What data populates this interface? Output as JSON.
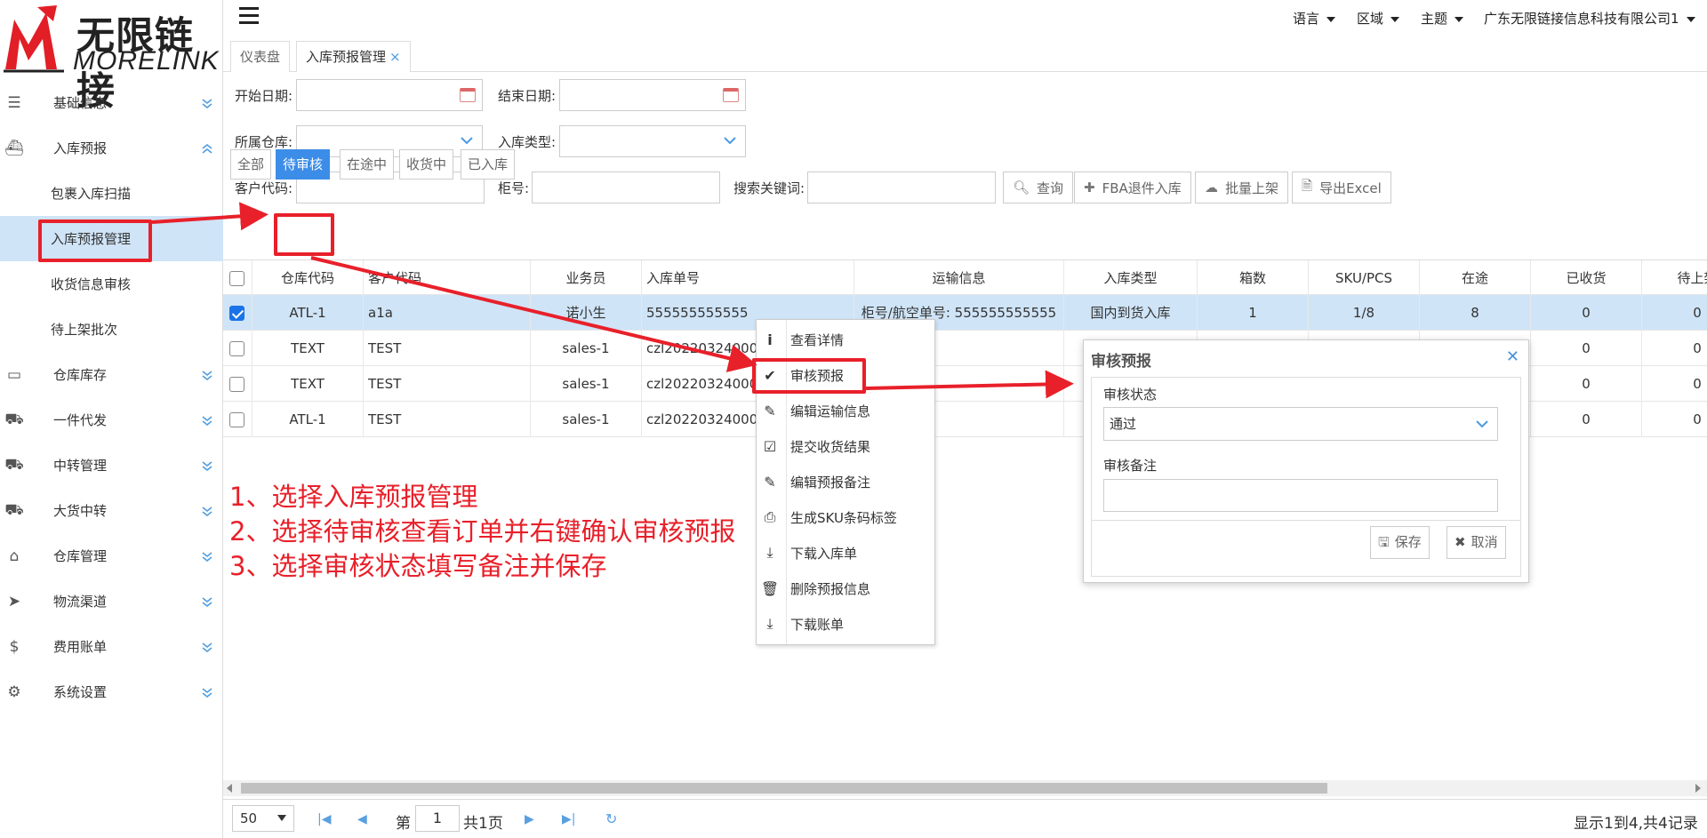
{
  "logo": {
    "cn": "无限链接",
    "en": "MORELINK"
  },
  "topbar": {
    "menus": [
      "语言",
      "区域",
      "主题",
      "广东无限链接信息科技有限公司1"
    ]
  },
  "tabs": [
    {
      "label": "仪表盘"
    },
    {
      "label": "入库预报管理",
      "close": "×"
    }
  ],
  "sidebar": {
    "items": [
      {
        "label": "基础信息",
        "icon": "list-icon"
      },
      {
        "label": "入库预报",
        "icon": "ship-icon",
        "expanded": true,
        "children": [
          "包裹入库扫描",
          "入库预报管理",
          "收货信息审核",
          "待上架批次"
        ]
      },
      {
        "label": "仓库库存",
        "icon": "inbox-icon"
      },
      {
        "label": "一件代发",
        "icon": "truck-icon"
      },
      {
        "label": "中转管理",
        "icon": "truck-icon"
      },
      {
        "label": "大货中转",
        "icon": "truck-icon"
      },
      {
        "label": "仓库管理",
        "icon": "home-icon"
      },
      {
        "label": "物流渠道",
        "icon": "cursor-icon"
      },
      {
        "label": "费用账单",
        "icon": "dollar-icon"
      },
      {
        "label": "系统设置",
        "icon": "gear-icon"
      }
    ]
  },
  "filters": {
    "start_date": "开始日期:",
    "end_date": "结束日期:",
    "warehouse": "所属仓库:",
    "inbound_type": "入库类型:",
    "customer_code": "客户代码:",
    "container_no": "柜号:",
    "keyword": "搜索关键词:",
    "query_btn": "查询",
    "fba_btn": "FBA退件入库",
    "batch_btn": "批量上架",
    "export_btn": "导出Excel"
  },
  "status_tabs": [
    "全部",
    "待审核",
    "在途中",
    "收货中",
    "已入库"
  ],
  "table": {
    "columns": [
      "仓库代码",
      "客户代码",
      "业务员",
      "入库单号",
      "运输信息",
      "入库类型",
      "箱数",
      "SKU/PCS",
      "在途",
      "已收货",
      "待上架"
    ],
    "rows": [
      [
        "ATL-1",
        "a1a",
        "诺小生",
        "555555555555",
        "柜号/航空单号: 555555555555",
        "国内到货入库",
        "1",
        "1/8",
        "8",
        "0",
        "0"
      ],
      [
        "TEXT",
        "TEST",
        "sales-1",
        "czl202203240004",
        "",
        "",
        "",
        "",
        "",
        "0",
        "0"
      ],
      [
        "TEXT",
        "TEST",
        "sales-1",
        "czl202203240004",
        "",
        "",
        "",
        "",
        "",
        "0",
        "0"
      ],
      [
        "ATL-1",
        "TEST",
        "sales-1",
        "czl202203240002",
        "",
        "",
        "",
        "",
        "",
        "0",
        "0"
      ]
    ]
  },
  "pager": {
    "page_size": "50",
    "page_prefix": "第",
    "page": "1",
    "page_suffix": "共1页",
    "summary": "显示1到4,共4记录"
  },
  "context_menu": [
    {
      "label": "查看详情",
      "icon": "info-icon"
    },
    {
      "label": "审核预报",
      "icon": "check-icon"
    },
    {
      "label": "编辑运输信息",
      "icon": "pencil-icon"
    },
    {
      "label": "提交收货结果",
      "icon": "calendar-check-icon"
    },
    {
      "label": "编辑预报备注",
      "icon": "pencil-icon"
    },
    {
      "label": "生成SKU条码标签",
      "icon": "printer-icon"
    },
    {
      "label": "下载入库单",
      "icon": "download-icon"
    },
    {
      "label": "删除预报信息",
      "icon": "trash-icon"
    },
    {
      "label": "下载账单",
      "icon": "download-icon"
    }
  ],
  "dialog": {
    "title": "审核预报",
    "status_label": "审核状态",
    "status_value": "通过",
    "remark_label": "审核备注",
    "save": "保存",
    "cancel": "取消"
  },
  "annotations": [
    "1、选择入库预报管理",
    "2、选择待审核查看订单并右键确认审核预报",
    "3、选择审核状态填写备注并保存"
  ],
  "colors": {
    "primary": "#3c8de8",
    "selected_row": "#cfe4f7",
    "annotation": "#e8202a"
  }
}
